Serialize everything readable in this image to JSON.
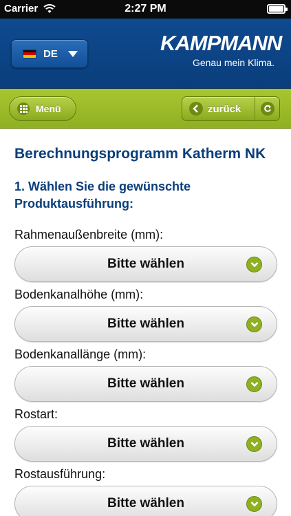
{
  "status_bar": {
    "carrier": "Carrier",
    "time": "2:27 PM"
  },
  "header": {
    "language_label": "DE",
    "logo_word": "KAMPMANN",
    "logo_tagline": "Genau mein Klima."
  },
  "navbar": {
    "menu_label": "Menü",
    "back_label": "zurück"
  },
  "content": {
    "title": "Berechnungsprogramm Katherm NK",
    "step_title": "1. Wählen Sie die gewünschte Produktausführung:",
    "fields": [
      {
        "label": "Rahmenaußenbreite (mm):",
        "value": "Bitte wählen"
      },
      {
        "label": "Bodenkanalhöhe (mm):",
        "value": "Bitte wählen"
      },
      {
        "label": "Bodenkanallänge (mm):",
        "value": "Bitte wählen"
      },
      {
        "label": "Rostart:",
        "value": "Bitte wählen"
      },
      {
        "label": "Rostausführung:",
        "value": "Bitte wählen"
      }
    ]
  },
  "colors": {
    "header_blue": "#0a3e7b",
    "accent_green": "#8fb021"
  },
  "icons": [
    "wifi-icon",
    "battery-icon",
    "german-flag-icon",
    "dropdown-caret-icon",
    "grid-menu-icon",
    "back-arrow-icon",
    "reload-icon",
    "chevron-down-icon"
  ]
}
